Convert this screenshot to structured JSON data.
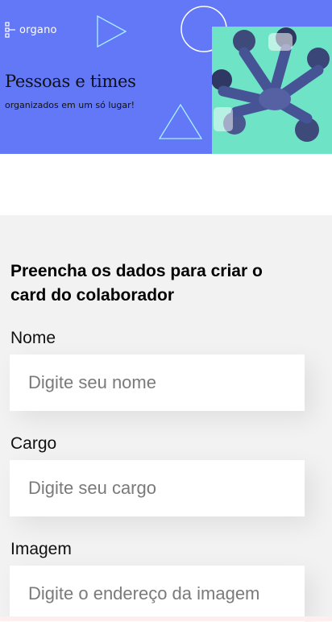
{
  "banner": {
    "logo_text": "organo",
    "title": "Pessoas e times",
    "subtitle": "organizados em um só lugar!",
    "background_color": "#6278f7",
    "photo_tint": "#5fe0c0"
  },
  "form": {
    "heading": "Preencha os dados para criar o card do colaborador",
    "fields": [
      {
        "label": "Nome",
        "placeholder": "Digite seu nome",
        "value": ""
      },
      {
        "label": "Cargo",
        "placeholder": "Digite seu cargo",
        "value": ""
      },
      {
        "label": "Imagem",
        "placeholder": "Digite o endereço da imagem",
        "value": ""
      }
    ]
  }
}
